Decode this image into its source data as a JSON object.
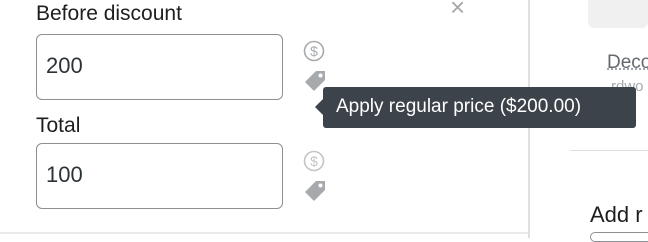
{
  "form": {
    "before_discount_label": "Before discount",
    "before_discount_value": "200",
    "total_label": "Total",
    "total_value": "100"
  },
  "tooltip": {
    "text": "Apply regular price ($200.00)"
  },
  "right_panel": {
    "link_text": "Deco",
    "partial_text": "rdwo",
    "add_label": "Add r"
  },
  "icons": {
    "dollar": "dollar-circle-icon",
    "tag": "price-tag-icon",
    "close": "close-icon"
  },
  "colors": {
    "tooltip_bg": "#3c434a",
    "field_border": "#8c8f94",
    "icon_gray": "#a7aaad"
  }
}
